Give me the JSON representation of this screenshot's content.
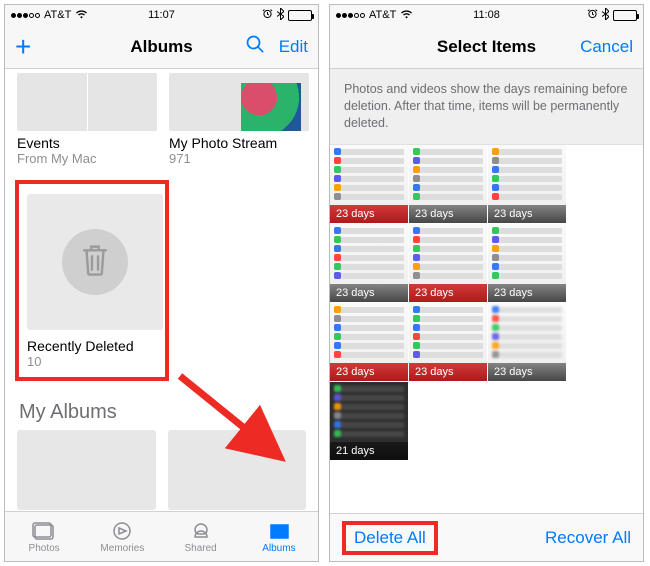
{
  "left": {
    "status": {
      "carrier": "AT&T",
      "time": "11:07"
    },
    "nav": {
      "title": "Albums",
      "edit": "Edit"
    },
    "topAlbums": [
      {
        "title": "Events",
        "sub": "From My Mac"
      },
      {
        "title": "My Photo Stream",
        "sub": "971"
      }
    ],
    "recent": {
      "title": "Recently Deleted",
      "count": "10"
    },
    "sectionHeader": "My Albums",
    "tabs": {
      "photos": "Photos",
      "memories": "Memories",
      "shared": "Shared",
      "albums": "Albums"
    }
  },
  "right": {
    "status": {
      "carrier": "AT&T",
      "time": "11:08"
    },
    "nav": {
      "title": "Select Items",
      "cancel": "Cancel"
    },
    "banner": "Photos and videos show the days remaining before deletion. After that time, items will be permanently deleted.",
    "items": [
      {
        "label": "23 days",
        "red": true
      },
      {
        "label": "23 days"
      },
      {
        "label": "23 days"
      },
      {
        "label": "23 days"
      },
      {
        "label": "23 days",
        "red": true
      },
      {
        "label": "23 days"
      },
      {
        "label": "23 days",
        "red": true
      },
      {
        "label": "23 days",
        "red": true
      },
      {
        "label": "23 days"
      },
      {
        "label": "21 days",
        "dark": true
      }
    ],
    "toolbar": {
      "deleteAll": "Delete All",
      "recoverAll": "Recover All"
    }
  }
}
